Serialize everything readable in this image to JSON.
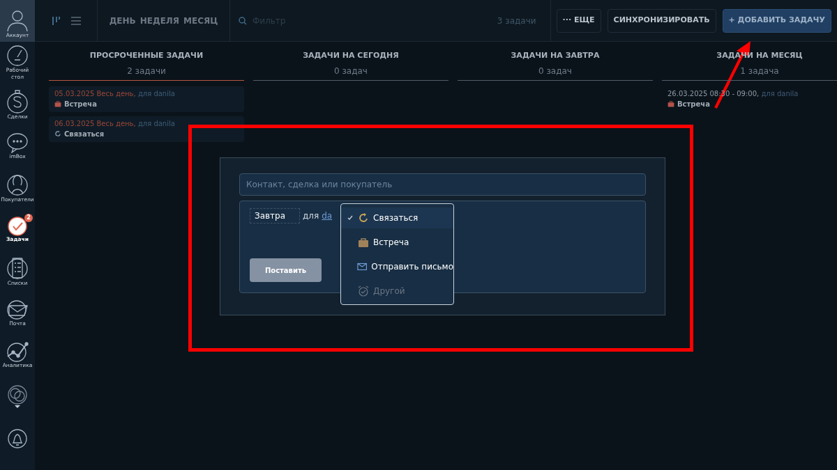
{
  "sidebar": {
    "items": [
      {
        "kind": "account",
        "label": "Аккаунт",
        "selected": false
      },
      {
        "kind": "dashboard",
        "label": "Рабочий стол",
        "selected": false
      },
      {
        "kind": "deals",
        "label": "Сделки",
        "selected": false
      },
      {
        "kind": "chat",
        "label": "imBox",
        "selected": false
      },
      {
        "kind": "customers",
        "label": "Покупатели",
        "selected": false
      },
      {
        "kind": "tasks",
        "label": "Задачи",
        "selected": true,
        "badge": "2"
      },
      {
        "kind": "lists",
        "label": "Списки",
        "selected": false
      },
      {
        "kind": "mail",
        "label": "Почта",
        "selected": false
      },
      {
        "kind": "analytics",
        "label": "Аналитика",
        "selected": false
      },
      {
        "kind": "market",
        "selected": false
      },
      {
        "kind": "bell",
        "selected": false
      }
    ]
  },
  "toolbar": {
    "periods": [
      "ДЕНЬ",
      "НЕДЕЛЯ",
      "МЕСЯЦ"
    ],
    "search": {
      "placeholder": "Фильтр"
    },
    "count": "3 задачи",
    "buttons": [
      {
        "kind": "more",
        "label": "··· ЕЩЕ"
      },
      {
        "kind": "plain",
        "label": "СИНХРОНИЗИРОВАТЬ"
      },
      {
        "kind": "primary",
        "label": "+ ДОБАВИТЬ ЗАДАЧУ"
      }
    ]
  },
  "columns": [
    {
      "title": "ПРОСРОЧЕННЫЕ ЗАДАЧИ",
      "count": "2 задачи",
      "overdue": true,
      "tasks": [
        {
          "when": "05.03.2025 Весь день,",
          "for": "для danila",
          "kind": "meeting",
          "name": "Встреча"
        },
        {
          "when": "06.03.2025 Весь день,",
          "for": "для danila",
          "kind": "call",
          "name": "Связаться"
        }
      ]
    },
    {
      "title": "ЗАДАЧИ НА СЕГОДНЯ",
      "count": "0 задач",
      "overdue": false
    },
    {
      "title": "ЗАДАЧИ НА ЗАВТРА",
      "count": "0 задач",
      "overdue": false
    },
    {
      "title": "ЗАДАЧИ НА МЕСЯЦ",
      "count": "1 задача",
      "overdue": false,
      "tasks": [
        {
          "when": "26.03.2025 08:30 - 09:00,",
          "for": "для danila",
          "kind": "meeting",
          "name": "Встреча"
        }
      ]
    }
  ],
  "new_task": {
    "target": {
      "placeholder": "Контакт, сделка или покупатель"
    },
    "date": "Завтра",
    "for_label": "для",
    "user": "da",
    "submit": "Поставить",
    "type_menu": [
      {
        "kind": "call",
        "label": "Связаться",
        "selected": true,
        "disabled": false
      },
      {
        "kind": "meeting",
        "label": "Встреча",
        "selected": false,
        "disabled": false
      },
      {
        "kind": "mail",
        "label": "Отправить письмо",
        "selected": false,
        "disabled": false
      },
      {
        "kind": "other",
        "label": "Другой",
        "selected": false,
        "disabled": true
      }
    ]
  }
}
